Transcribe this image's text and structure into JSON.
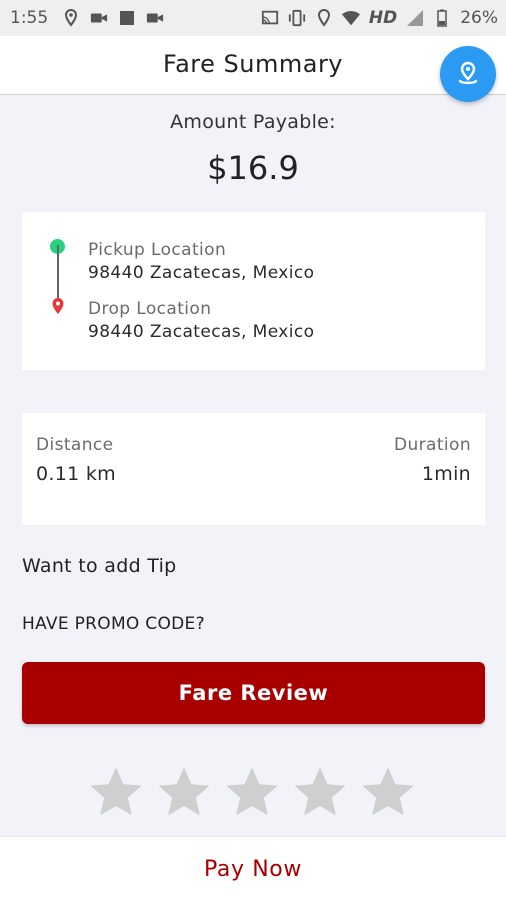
{
  "status_bar": {
    "time": "1:55",
    "network": "HD",
    "battery": "26%",
    "left_icons": [
      "location-pin-icon",
      "video-camera-icon",
      "stop-square-icon",
      "video-camera-icon"
    ],
    "right_icons": [
      "cast-icon",
      "vibrate-icon",
      "location-icon",
      "wifi-icon",
      "signal-icon",
      "battery-icon"
    ]
  },
  "header": {
    "title": "Fare Summary",
    "fab_icon": "map-pin-icon",
    "fab_color": "#2b9af3"
  },
  "amount": {
    "label": "Amount Payable:",
    "value": "$16.9"
  },
  "locations": {
    "pickup_label": "Pickup Location",
    "pickup_address": "98440 Zacatecas, Mexico",
    "drop_label": "Drop Location",
    "drop_address": "98440 Zacatecas, Mexico",
    "pickup_color": "#28d17c",
    "drop_color": "#e53935"
  },
  "trip": {
    "distance_label": "Distance",
    "distance_value": "0.11 km",
    "duration_label": "Duration",
    "duration_value": "1min"
  },
  "tip_text": "Want to add Tip",
  "promo_text": "HAVE PROMO CODE?",
  "fare_review_button": "Fare Review",
  "rating": {
    "max": 5,
    "selected": 0,
    "empty_color": "#cfcfcf"
  },
  "pay_now_button": "Pay Now",
  "brand_color": "#a80000"
}
